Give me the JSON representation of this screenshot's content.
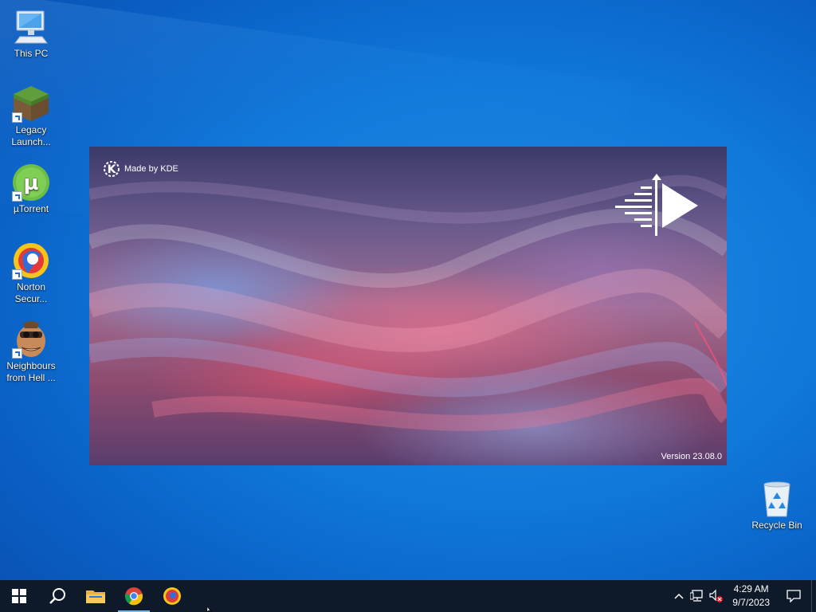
{
  "desktop": {
    "icons": [
      {
        "label": "This PC"
      },
      {
        "label": "Legacy Launch..."
      },
      {
        "label": "µTorrent"
      },
      {
        "label": "Norton Secur..."
      },
      {
        "label": "Neighbours from Hell ..."
      },
      {
        "label": "Recycle Bin"
      }
    ]
  },
  "splash": {
    "made_by": "Made by KDE",
    "version": "Version 23.08.0",
    "brand_colors": {
      "wave_pink": "#e06a8c",
      "wave_blue": "#7aa0e6",
      "base": "#6a5a8c"
    }
  },
  "taskbar": {
    "start_icon": "windows-start-icon",
    "search_icon": "search-icon",
    "pinned": [
      {
        "name": "file-explorer-icon"
      },
      {
        "name": "chrome-icon"
      },
      {
        "name": "norton-icon"
      }
    ],
    "tray": {
      "time": "4:29 AM",
      "date": "9/7/2023"
    }
  }
}
